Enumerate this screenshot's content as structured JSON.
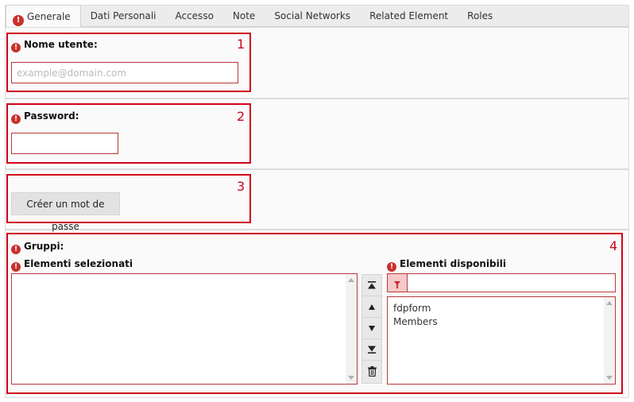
{
  "tabs": [
    {
      "label": "Generale",
      "active": true
    },
    {
      "label": "Dati Personali"
    },
    {
      "label": "Accesso"
    },
    {
      "label": "Note"
    },
    {
      "label": "Social Networks"
    },
    {
      "label": "Related Element"
    },
    {
      "label": "Roles"
    }
  ],
  "username": {
    "label": "Nome utente:",
    "placeholder": "example@domain.com",
    "value": ""
  },
  "password": {
    "label": "Password:",
    "value": ""
  },
  "generate": {
    "label": "Créer un mot de passe"
  },
  "groups": {
    "label": "Gruppi:",
    "selected_label": "Elementi selezionati",
    "available_label": "Elementi disponibili",
    "selected_items": [],
    "available_items": [
      "fdpform",
      "Members"
    ]
  },
  "boxes": [
    "1",
    "2",
    "3",
    "4"
  ],
  "colors": {
    "error": "#c9302c",
    "highlight": "#d0021b"
  }
}
